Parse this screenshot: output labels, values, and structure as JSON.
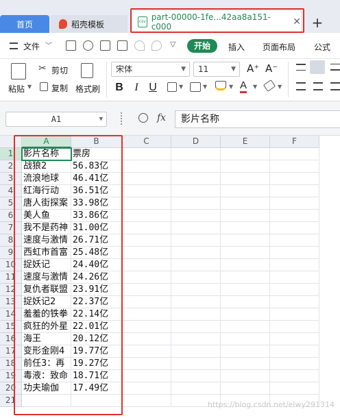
{
  "tabs": {
    "home": "首页",
    "template": "稻壳模板",
    "file": "part-00000-1fe...42aa8a151-c000",
    "file_icon": "csv-file-icon",
    "close_glyph": "✕",
    "add_glyph": "+"
  },
  "menu": {
    "file": "文件",
    "items": [
      "开始",
      "插入",
      "页面布局",
      "公式"
    ]
  },
  "ribbon": {
    "paste": "粘贴",
    "cut": "剪切",
    "copy": "复制",
    "format_painter": "格式刷",
    "font_name": "宋体",
    "font_size": "11",
    "grow_glyph": "A⁺",
    "shrink_glyph": "A⁻",
    "bold": "B",
    "italic": "I",
    "underline": "U",
    "font_color_glyph": "A"
  },
  "formula": {
    "cell_ref": "A1",
    "fx": "fx",
    "value": "影片名称"
  },
  "grid": {
    "columns": [
      "A",
      "B",
      "C",
      "D",
      "E",
      "F"
    ],
    "active_column": "A",
    "active_row": "1",
    "rows": [
      {
        "num": "1",
        "a": "影片名称",
        "b": "票房"
      },
      {
        "num": "2",
        "a": "战狼2",
        "b": "56.83亿"
      },
      {
        "num": "3",
        "a": "流浪地球",
        "b": "46.41亿"
      },
      {
        "num": "4",
        "a": "红海行动",
        "b": "36.51亿"
      },
      {
        "num": "5",
        "a": "唐人街探案",
        "b": "33.98亿"
      },
      {
        "num": "6",
        "a": "美人鱼",
        "b": "33.86亿"
      },
      {
        "num": "7",
        "a": "我不是药神",
        "b": "31.00亿"
      },
      {
        "num": "8",
        "a": "速度与激情",
        "b": "26.71亿"
      },
      {
        "num": "9",
        "a": "西虹市首富",
        "b": "25.48亿"
      },
      {
        "num": "10",
        "a": "捉妖记",
        "b": "24.40亿"
      },
      {
        "num": "11",
        "a": "速度与激情",
        "b": "24.26亿"
      },
      {
        "num": "12",
        "a": "复仇者联盟",
        "b": "23.91亿"
      },
      {
        "num": "13",
        "a": "捉妖记2",
        "b": "22.37亿"
      },
      {
        "num": "14",
        "a": "羞羞的铁拳",
        "b": "22.14亿"
      },
      {
        "num": "15",
        "a": "疯狂的外星",
        "b": "22.01亿"
      },
      {
        "num": "16",
        "a": "海王",
        "b": "20.12亿"
      },
      {
        "num": "17",
        "a": "变形金刚4",
        "b": "19.77亿"
      },
      {
        "num": "18",
        "a": "前任3：再",
        "b": "19.27亿"
      },
      {
        "num": "19",
        "a": "毒液：致命",
        "b": "18.71亿"
      },
      {
        "num": "20",
        "a": "功夫瑜伽",
        "b": "17.49亿"
      },
      {
        "num": "21",
        "a": "",
        "b": ""
      }
    ]
  },
  "watermark": "https://blog.csdn.net/elwy291314",
  "colors": {
    "accent_green": "#1f8a55",
    "tab_blue": "#4a88e6",
    "annotation_red": "#e03030"
  }
}
